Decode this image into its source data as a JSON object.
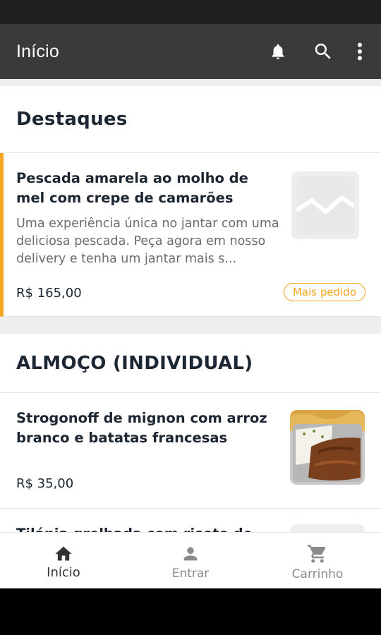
{
  "app_bar": {
    "title": "Início",
    "icons": [
      "bell-icon",
      "search-icon",
      "more-vert-icon"
    ]
  },
  "sections": [
    {
      "title": "Destaques",
      "products": [
        {
          "name": "Pescada amarela ao molho de mel com crepe de camarões",
          "description": "Uma experiência única no jantar com uma deliciosa pescada. Peça agora em nosso delivery e tenha um jantar mais s...",
          "price": "R$ 165,00",
          "badge": "Mais pedido",
          "image": "image-placeholder-icon"
        }
      ]
    },
    {
      "title": "ALMOÇO (INDIVIDUAL)",
      "products": [
        {
          "name": "Strogonoff de mignon com arroz branco e batatas francesas",
          "price": "R$ 35,00",
          "image": "strogonoff-photo"
        },
        {
          "name": "Tilápia grelhada com risoto de",
          "image": "image-placeholder-icon"
        }
      ]
    }
  ],
  "bottom_nav": [
    {
      "label": "Início",
      "icon": "home-icon",
      "active": true
    },
    {
      "label": "Entrar",
      "icon": "person-icon",
      "active": false
    },
    {
      "label": "Carrinho",
      "icon": "cart-icon",
      "active": false
    }
  ],
  "colors": {
    "app_bar": "#3a3a3a",
    "accent": "#f5a623",
    "text_dark": "#1d2733",
    "text_muted": "#6b6b6b"
  }
}
